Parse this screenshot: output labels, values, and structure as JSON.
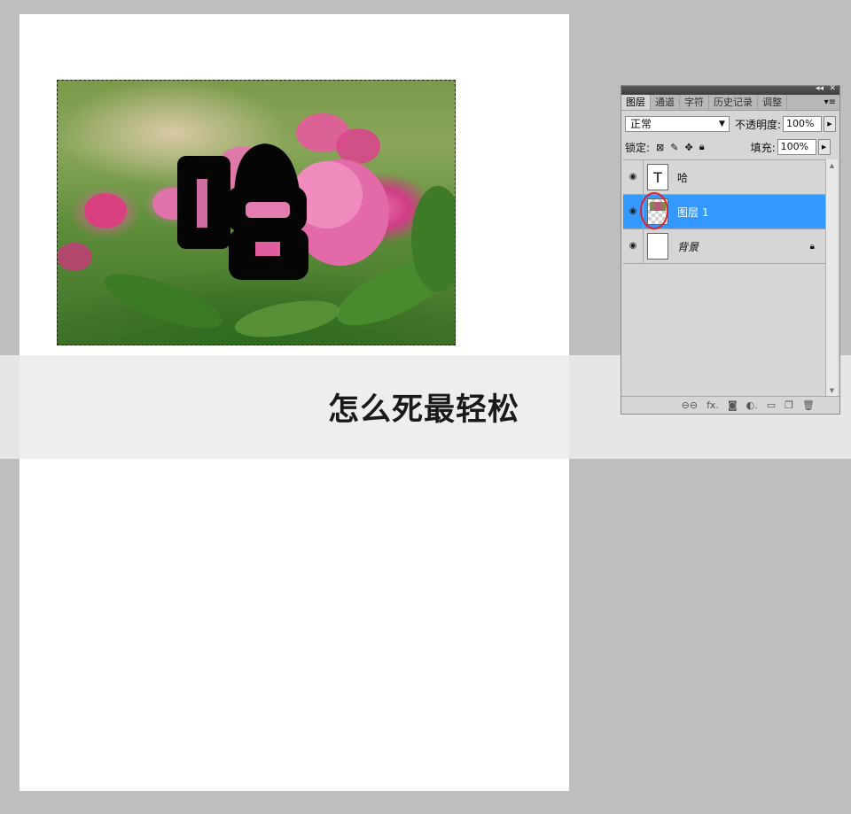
{
  "canvas": {
    "layer_text": "哈",
    "caption": "怎么死最轻松"
  },
  "panel": {
    "tabs": [
      "图层",
      "通道",
      "字符",
      "历史记录",
      "调整"
    ],
    "active_tab": "图层",
    "blend_mode": "正常",
    "opacity_label": "不透明度:",
    "opacity_value": "100%",
    "lock_label": "锁定:",
    "fill_label": "填充:",
    "fill_value": "100%",
    "layers": [
      {
        "name": "哈",
        "thumb": "T",
        "type": "text",
        "selected": false
      },
      {
        "name": "图层 1",
        "type": "image",
        "selected": true
      },
      {
        "name": "背景",
        "type": "background",
        "selected": false,
        "locked": true
      }
    ],
    "icons": [
      "link-icon",
      "fx-icon",
      "mask-icon",
      "adjustment-icon",
      "group-icon",
      "new-layer-icon",
      "trash-icon"
    ],
    "accent": "#3399ff",
    "highlight_circle": "#e0202a"
  }
}
